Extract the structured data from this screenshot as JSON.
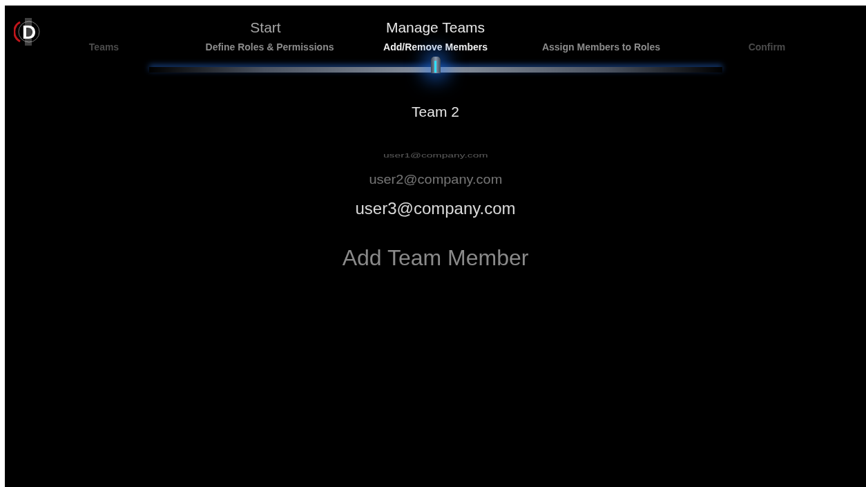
{
  "logo": {
    "letter": "D"
  },
  "phases": [
    {
      "label": "Start",
      "selected": false
    },
    {
      "label": "Manage Teams",
      "selected": true
    }
  ],
  "steps": [
    {
      "label": "Teams",
      "selected": false
    },
    {
      "label": "Define Roles & Permissions",
      "selected": false
    },
    {
      "label": "Add/Remove Members",
      "selected": true
    },
    {
      "label": "Assign Members to Roles",
      "selected": false
    },
    {
      "label": "Confirm",
      "selected": false
    }
  ],
  "team": {
    "title": "Team 2"
  },
  "members": [
    "user1@company.com",
    "user2@company.com",
    "user3@company.com"
  ],
  "add_member": {
    "placeholder": "Add Team Member"
  }
}
